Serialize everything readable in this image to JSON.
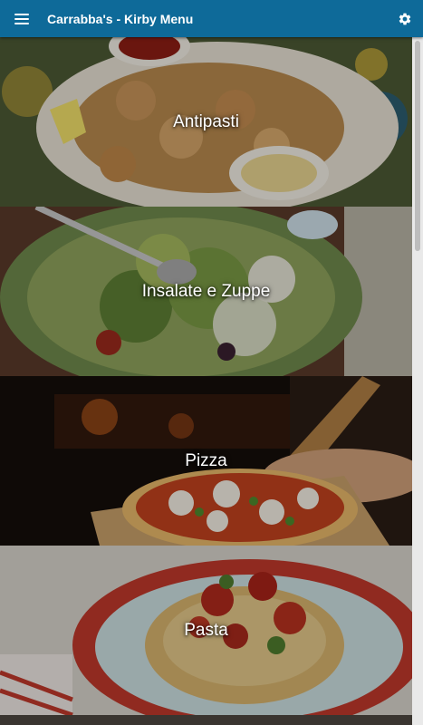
{
  "app": {
    "title": "Carrabba's - Kirby Menu"
  },
  "icons": {
    "menu": "hamburger-menu-icon",
    "settings": "gear-icon"
  },
  "colors": {
    "topbar": "#0e6a99",
    "label": "#ffffff"
  },
  "categories": [
    {
      "label": "Antipasti"
    },
    {
      "label": "Insalate e Zuppe"
    },
    {
      "label": "Pizza"
    },
    {
      "label": "Pasta"
    }
  ]
}
